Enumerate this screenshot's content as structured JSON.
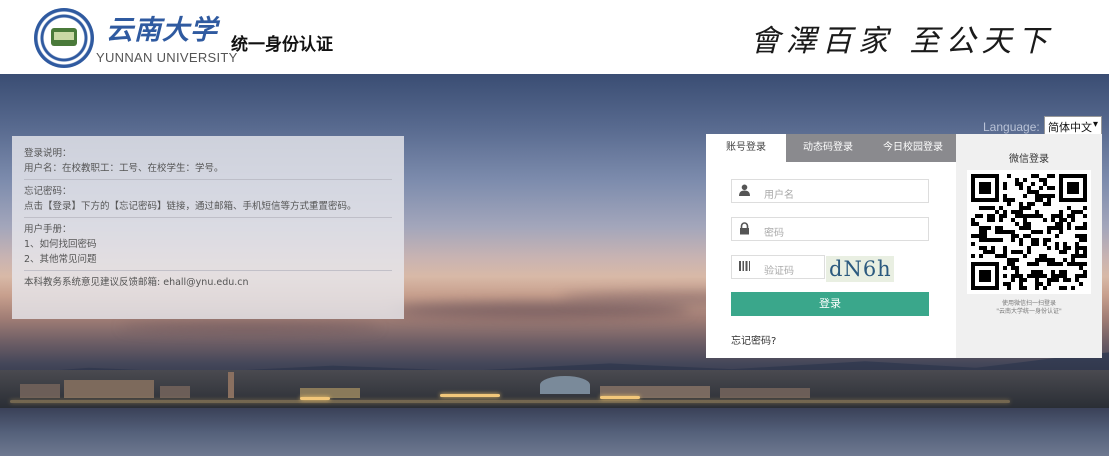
{
  "header": {
    "logo_cn": "云南大学",
    "logo_en": "YUNNAN UNIVERSITY",
    "system_title": "统一身份认证",
    "motto": "會澤百家 至公天下"
  },
  "language": {
    "label": "Language:",
    "selected": "简体中文"
  },
  "info": {
    "sections": [
      {
        "lines": [
          "登录说明：",
          "用户名：在校教职工：工号、在校学生：学号。"
        ]
      },
      {
        "lines": [
          "忘记密码：",
          "点击【登录】下方的【忘记密码】链接，通过邮箱、手机短信等方式重置密码。"
        ]
      },
      {
        "lines": [
          "用户手册：",
          "1、如何找回密码",
          "2、其他常见问题"
        ]
      },
      {
        "lines": [
          "本科教务系统意见建议反馈邮箱: ehall@ynu.edu.cn"
        ]
      }
    ]
  },
  "login": {
    "tabs": [
      {
        "label": "账号登录",
        "active": true
      },
      {
        "label": "动态码登录",
        "active": false
      },
      {
        "label": "今日校园登录",
        "active": false
      }
    ],
    "username_placeholder": "用户名",
    "password_placeholder": "密码",
    "captcha_placeholder": "验证码",
    "captcha_text": "dN6h",
    "submit_label": "登录",
    "forgot_label": "忘记密码?"
  },
  "qr": {
    "title": "微信登录",
    "caption_line1": "使用微信扫一扫登录",
    "caption_line2": "\"云南大学统一身份认证\""
  },
  "colors": {
    "accent_green": "#3aa78b",
    "tab_bar": "#8a8a8e",
    "brand_blue": "#2f5aa0"
  }
}
